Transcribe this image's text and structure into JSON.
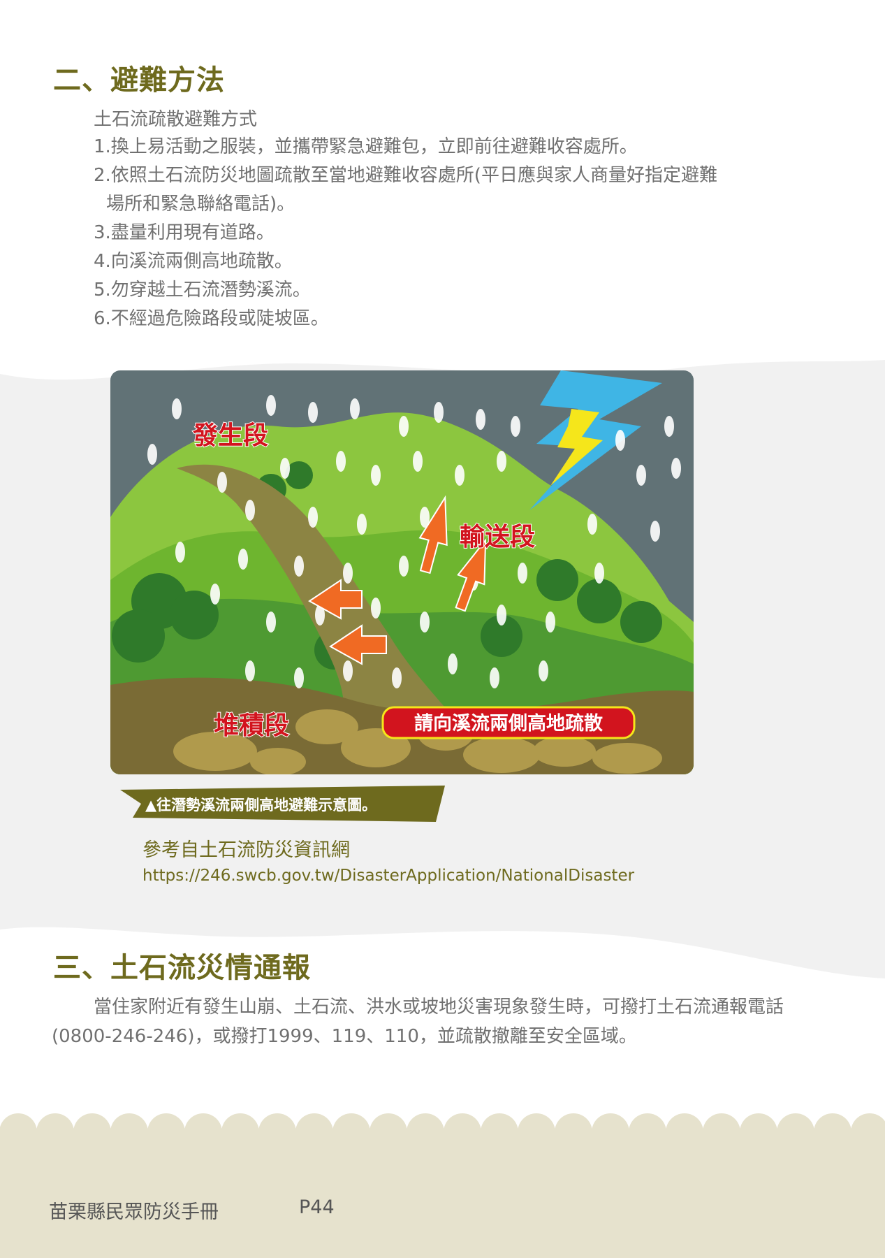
{
  "section_evac": {
    "heading": "二、避難方法",
    "subtitle": "土石流疏散避難方式",
    "steps": [
      "1.換上易活動之服裝，並攜帶緊急避難包，立即前往避難收容處所。",
      "2.依照土石流防災地圖疏散至當地避難收容處所(平日應與家人商量好指定避難",
      "場所和緊急聯絡電話)。",
      "3.盡量利用現有道路。",
      "4.向溪流兩側高地疏散。",
      "5.勿穿越土石流潛勢溪流。",
      "6.不經過危險路段或陡坡區。"
    ]
  },
  "figure": {
    "label_origin": "發生段",
    "label_transport": "輸送段",
    "label_deposit": "堆積段",
    "label_advice": "請向溪流兩側高地疏散",
    "caption": "▲往潛勢溪流兩側高地避難示意圖。",
    "colors": {
      "sky": "#617276",
      "hill_light": "#8cc63f",
      "hill_dark": "#3f8a2f",
      "ground": "#7a6b35",
      "arrow": "#f06a23",
      "label_red": "#d2141e",
      "lightning_blue": "#3fb5e5",
      "lightning_yellow": "#f5e61b"
    }
  },
  "reference": {
    "title": "參考自土石流防災資訊網",
    "url": "https://246.swcb.gov.tw/DisasterApplication/NationalDisaster"
  },
  "section_report": {
    "heading": "三、土石流災情通報",
    "paragraph": "當住家附近有發生山崩、土石流、洪水或坡地災害現象發生時，可撥打土石流通報電話(0800-246-246)，或撥打1999、119、110，並疏散撤離至安全區域。"
  },
  "footer": {
    "title": "苗栗縣民眾防災手冊",
    "page": "P44"
  }
}
